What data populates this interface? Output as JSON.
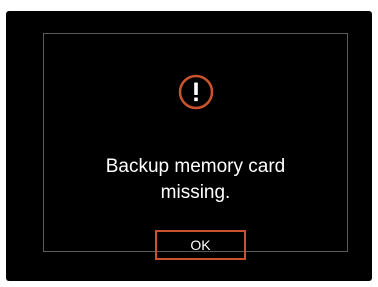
{
  "dialog": {
    "icon": "exclamation-circle-icon",
    "message_line1": "Backup memory card",
    "message_line2": "missing.",
    "ok_label": "OK"
  },
  "colors": {
    "background": "#000000",
    "accent": "#c8532e",
    "text": "#ffffff",
    "dialog_border": "#5a5a5a"
  }
}
